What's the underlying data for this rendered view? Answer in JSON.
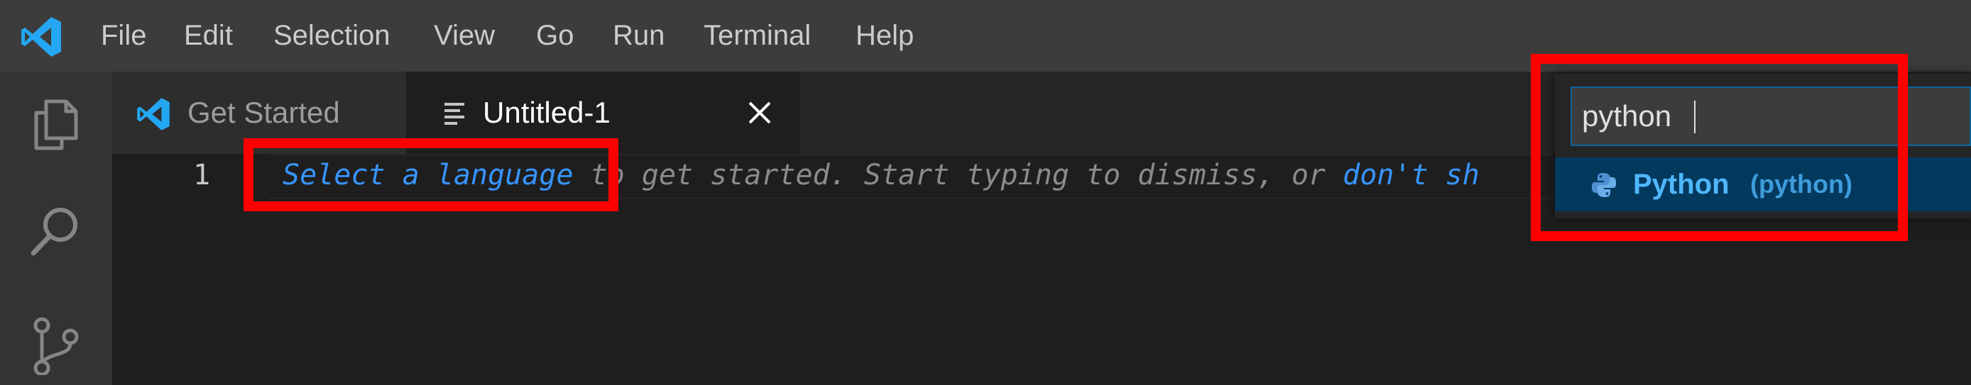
{
  "menubar": {
    "items": [
      "File",
      "Edit",
      "Selection",
      "View",
      "Go",
      "Run",
      "Terminal",
      "Help"
    ]
  },
  "activitybar": {
    "icons": [
      "explorer-icon",
      "search-icon",
      "source-control-icon"
    ]
  },
  "tabs": [
    {
      "label": "Get Started",
      "icon": "vscode-logo-icon",
      "active": false
    },
    {
      "label": "Untitled-1",
      "icon": "text-file-icon",
      "active": true
    }
  ],
  "editor": {
    "line_number": "1",
    "hint": {
      "link": "Select a language",
      "text": " to get started. Start typing to dismiss, or ",
      "link2": "don't sh"
    }
  },
  "quickpick": {
    "input_value": "python",
    "items": [
      {
        "label": "Python",
        "description": "(python)",
        "icon": "python-icon"
      }
    ]
  },
  "colors": {
    "accent": "#0e639c",
    "link": "#3794ff",
    "selection": "#04395e",
    "annotation": "#ff0000"
  }
}
